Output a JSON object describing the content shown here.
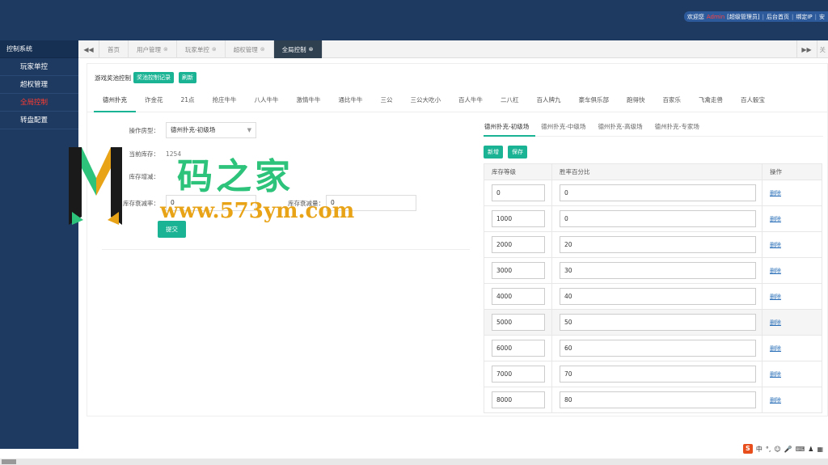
{
  "header": {
    "welcome": "欢迎您",
    "username": "Admin",
    "role": "[超级管理员]",
    "links": [
      "后台首页",
      "绑定IP",
      "安"
    ]
  },
  "sidebar": {
    "title": "控制系统",
    "items": [
      {
        "label": "玩家单控",
        "active": false
      },
      {
        "label": "超权管理",
        "active": false
      },
      {
        "label": "全局控制",
        "active": true
      },
      {
        "label": "转盘配置",
        "active": false
      }
    ]
  },
  "tabbar": {
    "prev_icon": "double-left-arrow",
    "next_icon": "double-right-arrow",
    "close_label": "关",
    "tabs": [
      {
        "label": "首页",
        "closable": false,
        "active": false
      },
      {
        "label": "用户管理",
        "closable": true,
        "active": false
      },
      {
        "label": "玩家单控",
        "closable": true,
        "active": false
      },
      {
        "label": "超权管理",
        "closable": true,
        "active": false
      },
      {
        "label": "全局控制",
        "closable": true,
        "active": true
      }
    ]
  },
  "toolbar": {
    "title": "游戏奖池控制",
    "record_button": "奖池控制记录",
    "refresh_button": "刷新"
  },
  "game_tabs": [
    "德州扑克",
    "诈金花",
    "21点",
    "抢庄牛牛",
    "八人牛牛",
    "激情牛牛",
    "通比牛牛",
    "三公",
    "三公大吃小",
    "百人牛牛",
    "二八杠",
    "百人牌九",
    "豪车俱乐部",
    "跑得快",
    "百家乐",
    "飞禽走兽",
    "百人骰宝"
  ],
  "form": {
    "room_type_label": "操作房型：",
    "room_type_value": "德州扑克-初级场",
    "current_stock_label": "当前库存：",
    "current_stock_value": "1254",
    "stock_decay_label": "库存增减：",
    "decay_rate_label": "库存衰减率：",
    "decay_rate_value": "0",
    "decay_amount_label": "库存衰减量：",
    "decay_amount_value": "0",
    "submit_button": "提交"
  },
  "room_tabs": [
    "德州扑克-初级场",
    "德州扑克-中级场",
    "德州扑克-高级场",
    "德州扑克-专家场"
  ],
  "table_actions": {
    "add": "新增",
    "save": "保存"
  },
  "table": {
    "headers": [
      "库存等级",
      "胜率百分比",
      "操作"
    ],
    "delete_label": "删除",
    "rows": [
      {
        "level": "0",
        "rate": "0"
      },
      {
        "level": "1000",
        "rate": "0"
      },
      {
        "level": "2000",
        "rate": "20"
      },
      {
        "level": "3000",
        "rate": "30"
      },
      {
        "level": "4000",
        "rate": "40"
      },
      {
        "level": "5000",
        "rate": "50",
        "highlight": true
      },
      {
        "level": "6000",
        "rate": "60"
      },
      {
        "level": "7000",
        "rate": "70"
      },
      {
        "level": "8000",
        "rate": "80"
      }
    ]
  },
  "watermark": {
    "title": "码之家",
    "url": "www.573ym.com"
  },
  "ime": {
    "logo": "S",
    "mode": "中"
  },
  "colors": {
    "header_bg": "#1f3a60",
    "accent": "#1ab394",
    "active_tab_bg": "#2f4050",
    "active_sidebar": "#ff3b30",
    "link": "#2a6fb8"
  }
}
